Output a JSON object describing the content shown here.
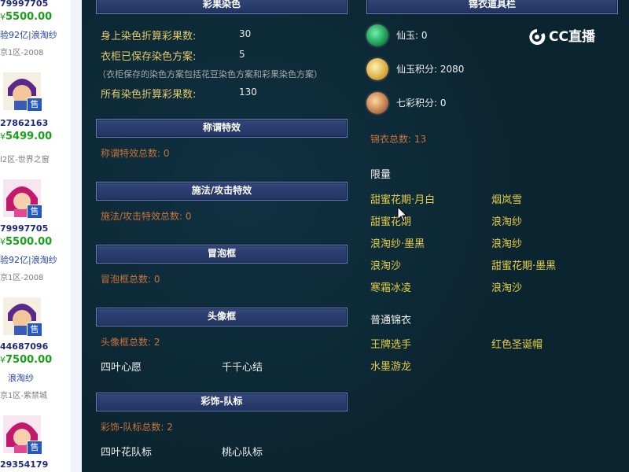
{
  "listing": [
    {
      "id": "79997705",
      "price": "5500.00",
      "tag": "验92亿|浪淘纱",
      "server": "京1区-2008"
    },
    {
      "id": "27862163",
      "price": "5499.00",
      "tag": "",
      "server": "l2区-世界之窗"
    },
    {
      "id": "79997705",
      "price": "5500.00",
      "tag": "验92亿|浪淘纱",
      "server": "京1区-2008"
    },
    {
      "id": "44687096",
      "price": "7500.00",
      "tag": "浪淘纱",
      "server": "京1区-紫禁城"
    },
    {
      "id": "29354179",
      "price": "",
      "tag": "",
      "server": ""
    }
  ],
  "listing_sell_badge": "售",
  "price_prefix": "¥",
  "sections": {
    "caiguo": {
      "title": "彩果染色",
      "body_label": "身上染色折算彩果数:",
      "body_value": "30",
      "wardrobe_label": "衣柜已保存染色方案:",
      "wardrobe_value": "5",
      "note": "（衣柜保存的染色方案包括花豆染色方案和彩果染色方案）",
      "total_label": "所有染色折算彩果数:",
      "total_value": "130"
    },
    "title_effect": {
      "title": "称谓特效",
      "total": "称谓特效总数: 0"
    },
    "cast_effect": {
      "title": "施法/攻击特效",
      "total": "施法/攻击特效总数: 0"
    },
    "bubble": {
      "title": "冒泡框",
      "total": "冒泡框总数: 0"
    },
    "avatar_frame": {
      "title": "头像框",
      "total": "头像框总数: 2",
      "items": [
        "四叶心愿",
        "千千心结"
      ]
    },
    "team_badge": {
      "title": "彩饰-队标",
      "total": "彩饰-队标总数: 2",
      "items": [
        "四叶花队标",
        "桃心队标"
      ]
    }
  },
  "jinyi": {
    "title": "锦衣道具栏",
    "currencies": [
      {
        "label": "仙玉: 0",
        "icon": "jade-icon",
        "color": "#1aa860"
      },
      {
        "label": "仙玉积分: 2080",
        "icon": "jade-points-icon",
        "color": "#d8b24a"
      },
      {
        "label": "七彩积分: 0",
        "icon": "rainbow-points-icon",
        "color": "#c98a5c"
      }
    ],
    "total": "锦衣总数: 13",
    "limited_heading": "限量",
    "limited": [
      "甜蜜花期·月白",
      "烟岚雪",
      "甜蜜花期",
      "浪淘纱",
      "浪淘纱·墨黑",
      "浪淘纱",
      "浪淘沙",
      "甜蜜花期·墨黑",
      "寒霜冰凌",
      "浪淘沙"
    ],
    "normal_heading": "普通锦衣",
    "normal": [
      "王牌选手",
      "红色圣诞帽",
      "水墨游龙"
    ]
  },
  "logo": "CC直播"
}
